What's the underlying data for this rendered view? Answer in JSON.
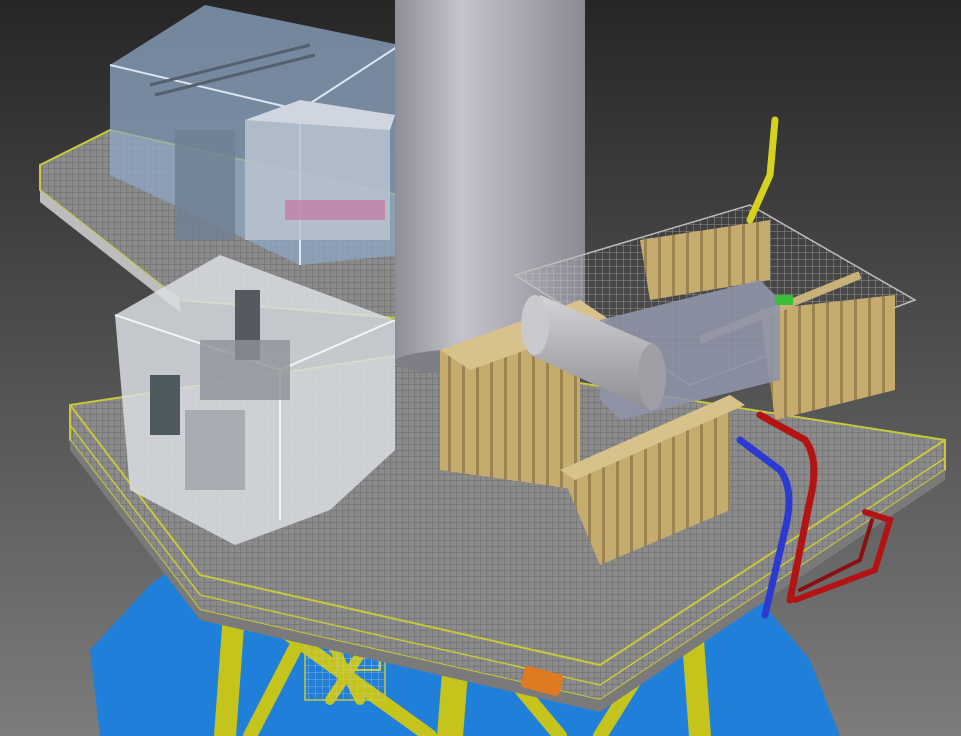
{
  "colors": {
    "background_top": "#2a2a2a",
    "background_bottom": "#7a7a7a",
    "sea": "#1f7fd9",
    "jacket_yellow": "#c8c81e",
    "deck_grey": "#8f8f8f",
    "tower_grey": "#a9a9b2",
    "module_blue": "#8da7c4",
    "module_white": "#d9dde2",
    "radiator_tan": "#c8ae72",
    "pipe_blue": "#2c3ad0",
    "pipe_red": "#b31313",
    "tank_grey": "#b8b8bc",
    "orange_equipment": "#e07a22"
  },
  "icons": [
    "offshore-platform-scene"
  ]
}
